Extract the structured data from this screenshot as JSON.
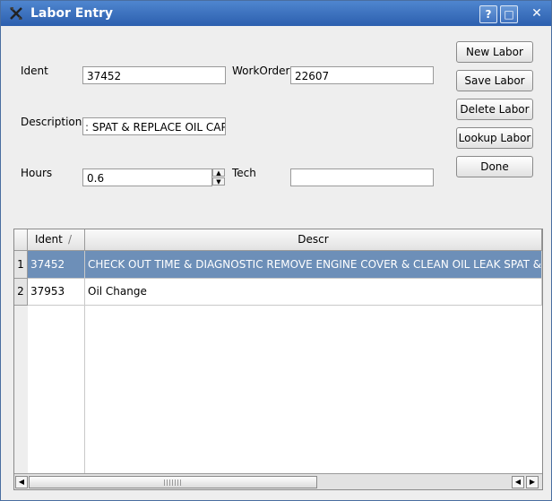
{
  "window": {
    "title": "Labor Entry"
  },
  "titlebar_buttons": {
    "help": "?",
    "maximize": "□",
    "close": "✕"
  },
  "form": {
    "ident_label": "Ident",
    "ident_value": "37452",
    "workorder_label": "WorkOrder",
    "workorder_value": "22607",
    "description_label": "Description",
    "description_value": "SPAT & REPLACE OIL CAP",
    "hours_label": "Hours",
    "hours_value": "0.6",
    "tech_label": "Tech",
    "tech_value": ""
  },
  "buttons": {
    "new": "New Labor",
    "save": "Save Labor",
    "delete": "Delete Labor",
    "lookup": "Lookup Labor",
    "done": "Done"
  },
  "table": {
    "columns": [
      "Ident",
      "Descr"
    ],
    "sort_indicator": "/",
    "rows": [
      {
        "num": "1",
        "ident": "37452",
        "descr": "CHECK OUT TIME & DIAGNOSTIC REMOVE ENGINE COVER & CLEAN OIL LEAK SPAT & REPLACE OIL CAP",
        "selected": true
      },
      {
        "num": "2",
        "ident": "37953",
        "descr": "Oil Change",
        "selected": false
      }
    ]
  },
  "scrollbar": {
    "left_arrow": "◀",
    "right_arrow": "▶"
  }
}
